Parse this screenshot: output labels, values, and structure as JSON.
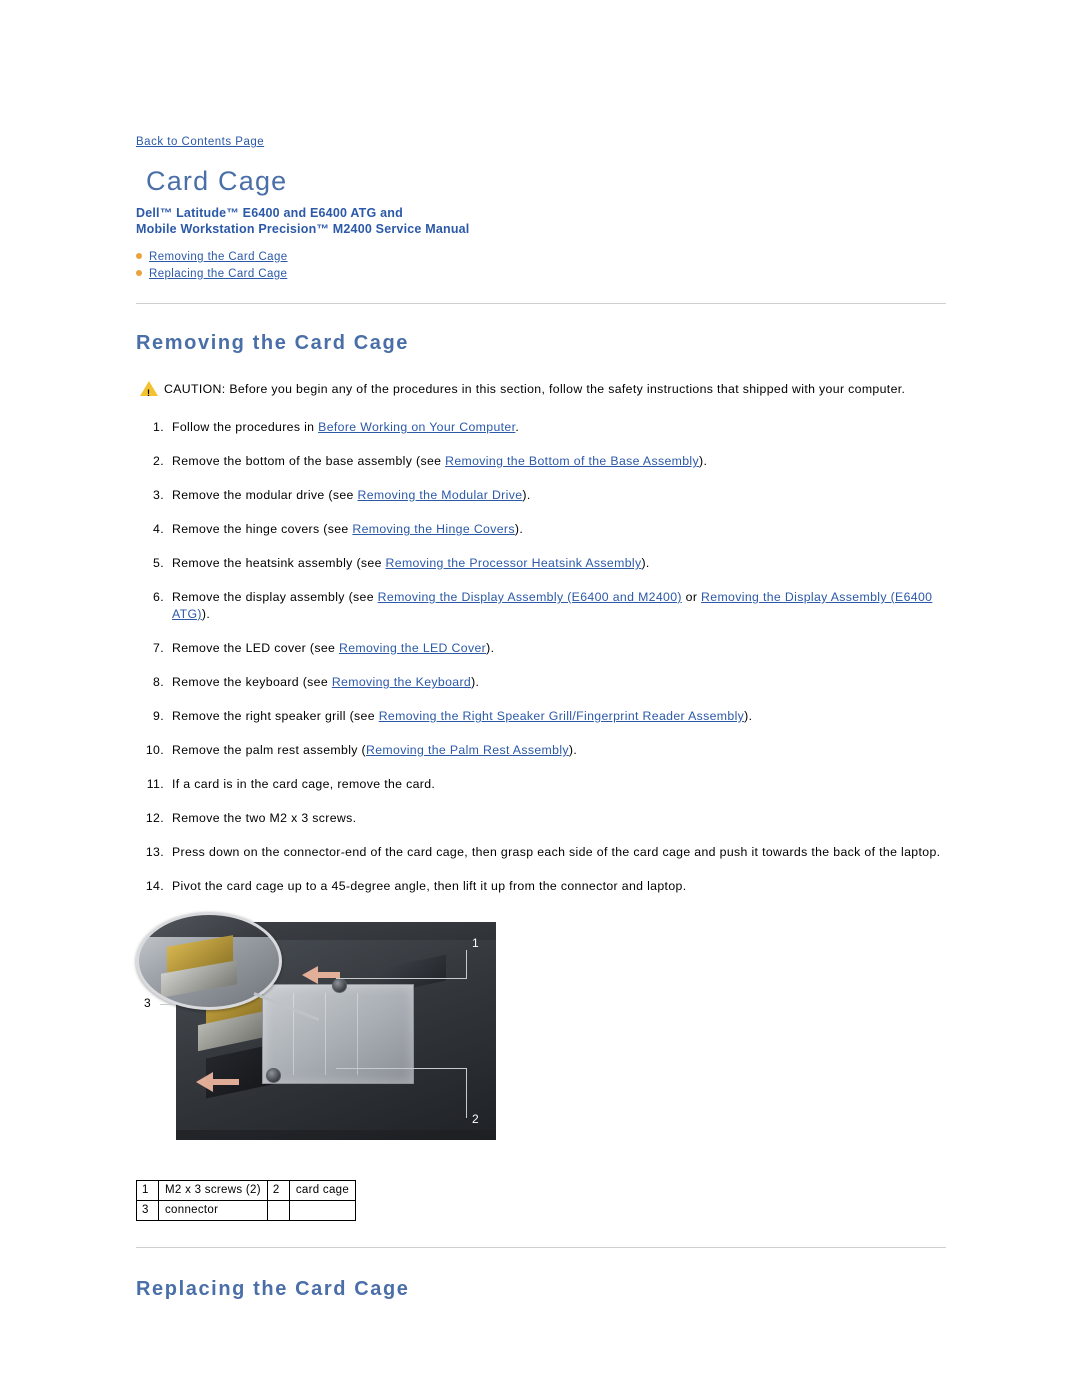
{
  "document": {
    "back_link": "Back to Contents Page",
    "title": "Card Cage",
    "subtitle_line1": "Dell™ Latitude™ E6400 and E6400 ATG and",
    "subtitle_line2": "Mobile Workstation Precision™ M2400 Service Manual",
    "toc": [
      {
        "label": "Removing the Card Cage"
      },
      {
        "label": "Replacing the Card Cage"
      }
    ],
    "section_removing": "Removing the Card Cage",
    "section_replacing": "Replacing the Card Cage",
    "caution": "CAUTION: Before you begin any of the procedures in this section, follow the safety instructions that shipped with your computer.",
    "steps": [
      {
        "pre": "Follow the procedures in ",
        "link": "Before Working on Your Computer",
        "post": "."
      },
      {
        "pre": "Remove the bottom of the base assembly (see ",
        "link": "Removing the Bottom of the Base Assembly",
        "post": ")."
      },
      {
        "pre": "Remove the modular drive (see ",
        "link": "Removing the Modular Drive",
        "post": ")."
      },
      {
        "pre": "Remove the hinge covers (see ",
        "link": "Removing the Hinge Covers",
        "post": ")."
      },
      {
        "pre": "Remove the heatsink assembly (see ",
        "link": "Removing the Processor Heatsink Assembly",
        "post": ")."
      },
      {
        "pre": "Remove the display assembly (see ",
        "link": "Removing the Display Assembly (E6400 and M2400)",
        "mid": " or ",
        "link2": "Removing the Display Assembly (E6400 ATG)",
        "post": ")."
      },
      {
        "pre": "Remove the LED cover (see ",
        "link": "Removing the LED Cover",
        "post": ")."
      },
      {
        "pre": "Remove the keyboard (see ",
        "link": "Removing the Keyboard",
        "post": ")."
      },
      {
        "pre": "Remove the right speaker grill (see ",
        "link": "Removing the Right Speaker Grill/Fingerprint Reader Assembly",
        "post": ")."
      },
      {
        "pre": "Remove the palm rest assembly (",
        "link": "Removing the Palm Rest Assembly",
        "post": ")."
      },
      {
        "pre": "If a card is in the card cage, remove the card.",
        "link": "",
        "post": ""
      },
      {
        "pre": "Remove the two M2 x 3 screws.",
        "link": "",
        "post": ""
      },
      {
        "pre": "Press down on the connector-end of the card cage, then grasp each side of the card cage and push it towards the back of the laptop.",
        "link": "",
        "post": ""
      },
      {
        "pre": "Pivot the card cage up to a 45-degree angle, then lift it up from the connector and laptop.",
        "link": "",
        "post": ""
      }
    ],
    "figure": {
      "callouts": [
        {
          "num": "1"
        },
        {
          "num": "2"
        },
        {
          "num": "3"
        }
      ],
      "legend": [
        {
          "num": "1",
          "label": "M2 x 3 screws (2)",
          "num2": "2",
          "label2": "card cage"
        },
        {
          "num": "3",
          "label": "connector",
          "num2": "",
          "label2": ""
        }
      ]
    },
    "colors": {
      "heading": "#4a6fa8",
      "link": "#2b59a8",
      "bullet": "#e8a33d",
      "caution_icon": "#f2c230"
    }
  }
}
